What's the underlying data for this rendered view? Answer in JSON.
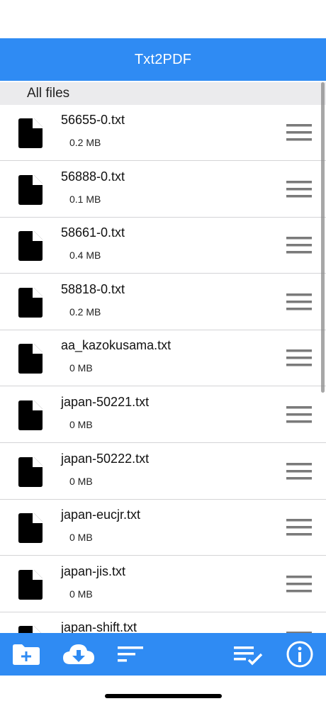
{
  "header": {
    "title": "Txt2PDF"
  },
  "section": {
    "title": "All files"
  },
  "files": [
    {
      "name": "56655-0.txt",
      "size": "0.2 MB"
    },
    {
      "name": "56888-0.txt",
      "size": "0.1 MB"
    },
    {
      "name": "58661-0.txt",
      "size": "0.4 MB"
    },
    {
      "name": "58818-0.txt",
      "size": "0.2 MB"
    },
    {
      "name": "aa_kazokusama.txt",
      "size": "0 MB"
    },
    {
      "name": "japan-50221.txt",
      "size": "0 MB"
    },
    {
      "name": "japan-50222.txt",
      "size": "0 MB"
    },
    {
      "name": "japan-eucjr.txt",
      "size": "0 MB"
    },
    {
      "name": "japan-jis.txt",
      "size": "0 MB"
    },
    {
      "name": "japan-shift.txt",
      "size": ""
    }
  ],
  "toolbar": {
    "icons": [
      "add-folder-icon",
      "cloud-download-icon",
      "sort-icon",
      "select-list-icon",
      "info-icon"
    ]
  },
  "colors": {
    "accent": "#2f8bf3",
    "section_bg": "#ebebed",
    "divider": "#d4d4d6"
  }
}
